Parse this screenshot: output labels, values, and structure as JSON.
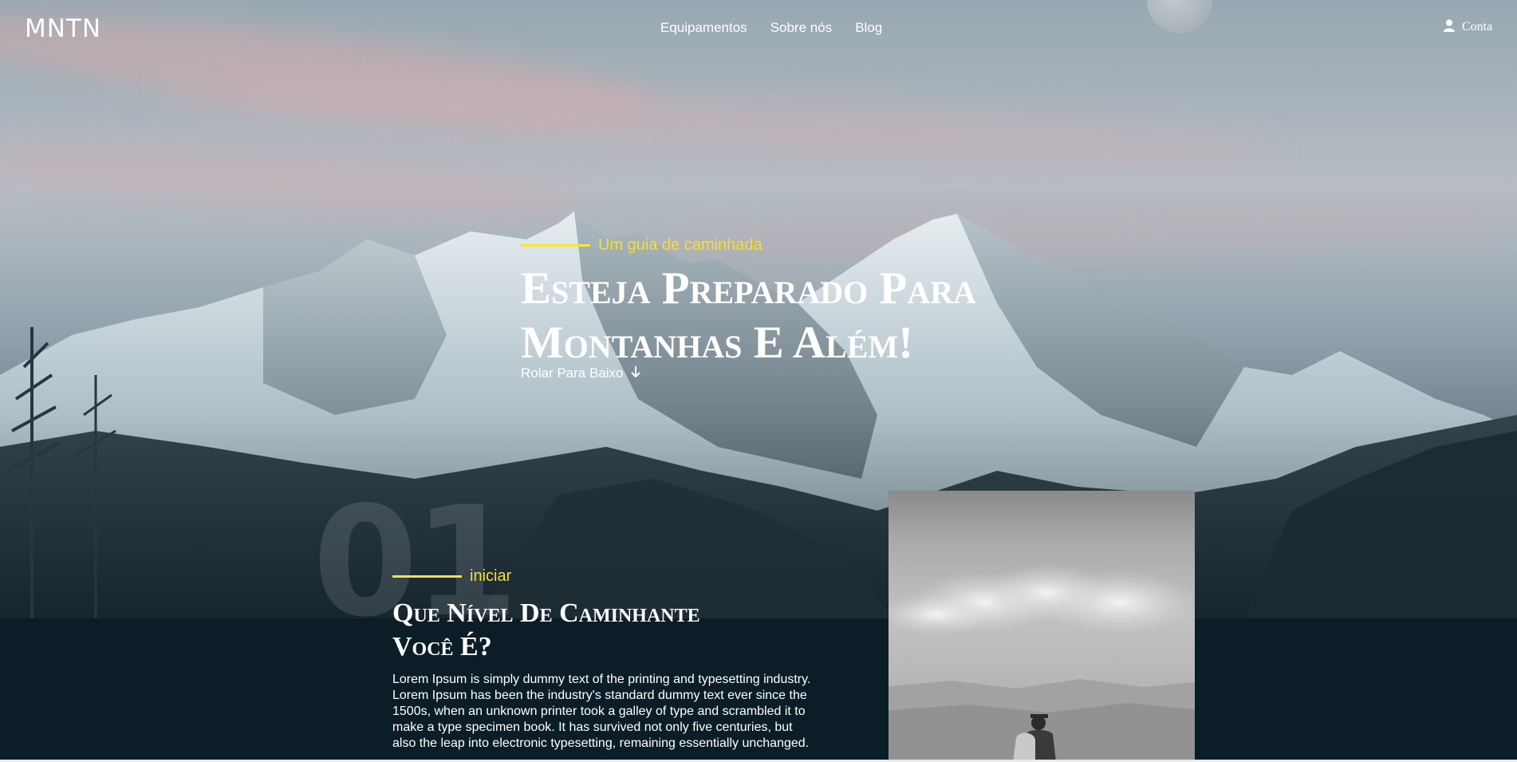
{
  "header": {
    "logo": "MNTN",
    "nav": [
      {
        "label": "Equipamentos"
      },
      {
        "label": "Sobre nós"
      },
      {
        "label": "Blog"
      }
    ],
    "account_label": "Conta"
  },
  "hero": {
    "eyebrow": "Um guia de caminhada",
    "title_line1": "Esteja Preparado Para",
    "title_line2": "Montanhas E Além!",
    "scroll_label": "Rolar Para Baixo"
  },
  "section": {
    "number": "01",
    "eyebrow": "iniciar",
    "title_line1": "Que Nível De Caminhante",
    "title_line2": "Você É?",
    "body": "Lorem Ipsum is simply dummy text of the printing and typesetting industry. Lorem Ipsum has been the industry's standard dummy text ever since the 1500s, when an unknown printer took a galley of type and scrambled it to make a type specimen book. It has survived not only five centuries, but also the leap into electronic typesetting, remaining essentially unchanged."
  },
  "colors": {
    "accent": "#f3de3a",
    "dark_bg": "#0b1d26"
  },
  "icons": {
    "account": "user-icon",
    "scroll": "arrow-down-icon"
  }
}
